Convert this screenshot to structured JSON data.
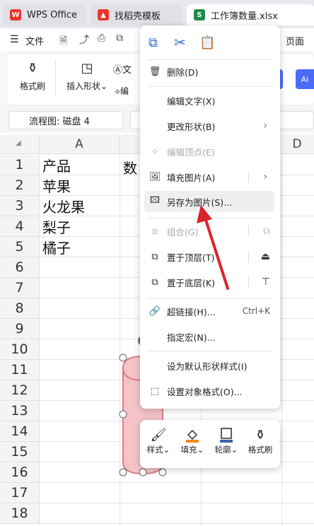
{
  "tabs": [
    {
      "label": "WPS Office",
      "icon": "wps-logo-icon",
      "color": "#e8362d"
    },
    {
      "label": "找稻壳模板",
      "icon": "daoke-logo-icon",
      "color": "#e8362d"
    },
    {
      "label": "工作簿数量.xlsx",
      "icon": "spreadsheet-s-icon",
      "color": "#1f8a4c"
    }
  ],
  "menubar": {
    "file": "文件",
    "page": "页面"
  },
  "ribbon": {
    "format_painter": "格式刷",
    "insert_shape": "插入形状",
    "text_box": "文",
    "edit_points": "编",
    "blue_button": "Ai"
  },
  "formula": {
    "name_box": "流程图: 磁盘 4"
  },
  "sheet": {
    "col_a": "A",
    "col_d": "D",
    "rows": [
      "1",
      "2",
      "3",
      "4",
      "5",
      "6",
      "7",
      "8",
      "9",
      "10",
      "11",
      "12",
      "13",
      "14",
      "15",
      "16",
      "17",
      "18"
    ],
    "cells_a": [
      "产品",
      "苹果",
      "火龙果",
      "梨子",
      "橘子"
    ],
    "cell_b1": "数"
  },
  "context_menu": {
    "top_icons": [
      "copy-icon",
      "cut-icon",
      "paste-icon"
    ],
    "items": [
      {
        "label": "删除(D)",
        "icon": "trash-icon",
        "disabled": false
      },
      {
        "label": "编辑文字(X)",
        "icon": "",
        "disabled": false
      },
      {
        "label": "更改形状(B)",
        "icon": "",
        "disabled": false,
        "arrow": "›"
      },
      {
        "label": "编辑顶点(E)",
        "icon": "edit-points-icon",
        "disabled": true
      },
      {
        "label": "填充图片(A)",
        "icon": "fill-image-icon",
        "disabled": false,
        "arrow": "›"
      },
      {
        "label": "另存为图片(S)...",
        "icon": "save-image-icon",
        "disabled": false,
        "highlight": true
      },
      {
        "label": "组合(G)",
        "icon": "group-icon",
        "disabled": true
      },
      {
        "label": "置于顶层(T)",
        "icon": "bring-front-icon",
        "disabled": false
      },
      {
        "label": "置于底层(K)",
        "icon": "send-back-icon",
        "disabled": false
      },
      {
        "label": "超链接(H)...",
        "icon": "link-icon",
        "disabled": false,
        "shortcut": "Ctrl+K"
      },
      {
        "label": "指定宏(N)...",
        "icon": "",
        "disabled": false
      },
      {
        "label": "设为默认形状样式(I)",
        "icon": "",
        "disabled": false
      },
      {
        "label": "设置对象格式(O)...",
        "icon": "format-object-icon",
        "disabled": false
      }
    ]
  },
  "shape_toolbar": [
    {
      "label": "样式",
      "icon": "brush-icon",
      "dropdown": true
    },
    {
      "label": "填充",
      "icon": "fill-bucket-icon",
      "dropdown": true
    },
    {
      "label": "轮廓",
      "icon": "outline-icon",
      "dropdown": true
    },
    {
      "label": "格式刷",
      "icon": "format-painter-icon",
      "dropdown": false
    }
  ],
  "colors": {
    "accent_red": "#d9232d",
    "shape_fill": "#f3c3c8",
    "shape_stroke": "#e07a86",
    "sheet_green": "#1f8a4c"
  }
}
